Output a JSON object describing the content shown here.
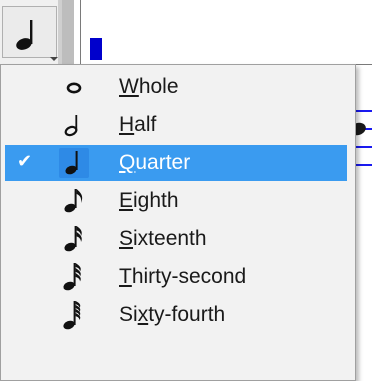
{
  "toolbar": {
    "note_button_icon": "quarter-note-icon",
    "has_dropdown": true
  },
  "menu": {
    "items": [
      {
        "label": "Whole",
        "mnemonic_index": 0,
        "icon": "whole-note-icon",
        "checked": false
      },
      {
        "label": "Half",
        "mnemonic_index": 0,
        "icon": "half-note-icon",
        "checked": false
      },
      {
        "label": "Quarter",
        "mnemonic_index": 0,
        "icon": "quarter-note-icon",
        "checked": true
      },
      {
        "label": "Eighth",
        "mnemonic_index": 0,
        "icon": "eighth-note-icon",
        "checked": false
      },
      {
        "label": "Sixteenth",
        "mnemonic_index": 0,
        "icon": "sixteenth-note-icon",
        "checked": false
      },
      {
        "label": "Thirty-second",
        "mnemonic_index": 0,
        "icon": "thirty-second-note-icon",
        "checked": false
      },
      {
        "label": "Sixty-fourth",
        "mnemonic_index": 2,
        "icon": "sixty-fourth-note-icon",
        "checked": false
      }
    ],
    "check_glyph": "✔"
  },
  "colors": {
    "selection": "#3a9bf0",
    "cursor": "#0000cc",
    "staff": "#1a1af0",
    "menu_bg": "#f2f2f2"
  }
}
